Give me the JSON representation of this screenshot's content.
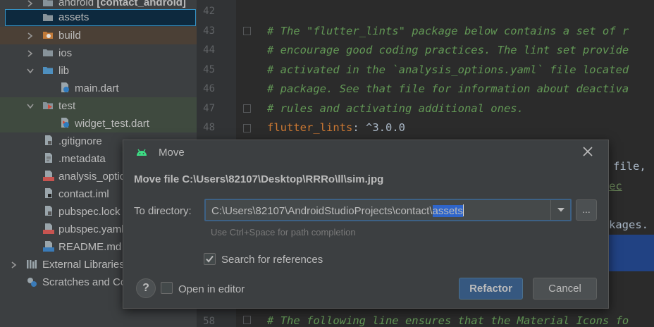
{
  "tree": {
    "items": [
      {
        "label": "android",
        "suffix": "[contact_android]",
        "icon": "folder-icon"
      },
      {
        "label": "assets",
        "icon": "folder-icon"
      },
      {
        "label": "build",
        "icon": "excluded-folder-icon"
      },
      {
        "label": "ios",
        "icon": "folder-icon"
      },
      {
        "label": "lib",
        "icon": "source-folder-icon"
      },
      {
        "label": "main.dart",
        "icon": "dart-file-icon"
      },
      {
        "label": "test",
        "icon": "test-folder-icon"
      },
      {
        "label": "widget_test.dart",
        "icon": "dart-file-icon"
      },
      {
        "label": ".gitignore",
        "icon": "file-icon"
      },
      {
        "label": ".metadata",
        "icon": "file-icon"
      },
      {
        "label": "analysis_optic",
        "icon": "yml-file-icon",
        "badge": "YML"
      },
      {
        "label": "contact.iml",
        "icon": "iml-file-icon"
      },
      {
        "label": "pubspec.lock",
        "icon": "file-icon"
      },
      {
        "label": "pubspec.yaml",
        "icon": "yml-file-icon",
        "badge": "YML"
      },
      {
        "label": "README.md",
        "icon": "md-file-icon",
        "badge": "MD"
      },
      {
        "label": "External Libraries",
        "icon": "libraries-icon"
      },
      {
        "label": "Scratches and Co",
        "icon": "scratches-icon"
      }
    ]
  },
  "editor": {
    "line_numbers": [
      "42",
      "43",
      "44",
      "45",
      "46",
      "47",
      "48",
      "58"
    ],
    "lines": [
      {
        "text": "# The \"flutter_lints\" package below contains a set of r"
      },
      {
        "text": "# encourage good coding practices. The lint set provide"
      },
      {
        "text": "# activated in the `analysis_options.yaml` file located"
      },
      {
        "text": "# package. See that file for information about deactiva"
      },
      {
        "text": "# rules and activating additional ones."
      },
      {
        "key": "flutter_lints",
        "colon": ":",
        "value": " ^3.0.0"
      },
      {
        "text": "# The following line ensures that the Material Icons fo"
      }
    ],
    "behind_dialog": [
      "file,",
      "ec",
      "kages."
    ]
  },
  "dialog": {
    "title": "Move",
    "heading": "Move file C:\\Users\\82107\\Desktop\\RRRo\\ll\\sim.jpg",
    "to_directory_label": "To directory:",
    "directory_value": "C:\\Users\\82107\\AndroidStudioProjects\\contact\\",
    "directory_selected": "assets",
    "browse_label": "...",
    "hint": "Use Ctrl+Space for path completion",
    "search_references_label": "Search for references",
    "search_references_checked": true,
    "open_in_editor_label": "Open in editor",
    "open_in_editor_checked": false,
    "help_label": "?",
    "refactor_label": "Refactor",
    "cancel_label": "Cancel"
  },
  "colors": {
    "comment": "#629755",
    "key": "#cc7832",
    "accent": "#365880",
    "selection": "#2f65ca",
    "android_green": "#3ddc84"
  }
}
